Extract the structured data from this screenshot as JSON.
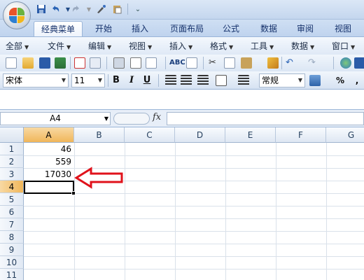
{
  "ribbon_tabs": [
    "经典菜单",
    "开始",
    "插入",
    "页面布局",
    "公式",
    "数据",
    "审阅",
    "视图"
  ],
  "menus": [
    "全部",
    "文件",
    "编辑",
    "视图",
    "插入",
    "格式",
    "工具",
    "数据",
    "窗口"
  ],
  "font": {
    "name": "宋体",
    "size": "11"
  },
  "format_buttons": {
    "bold": "B",
    "italic": "I",
    "underline": "U"
  },
  "number_format": "常规",
  "percent": "%",
  "comma": ",",
  "namebox": "A4",
  "fx_label": "fx",
  "formula_value": "",
  "columns": [
    "A",
    "B",
    "C",
    "D",
    "E",
    "F",
    "G"
  ],
  "rows": [
    "1",
    "2",
    "3",
    "4",
    "5",
    "6",
    "7",
    "8",
    "9",
    "10",
    "11"
  ],
  "cells": {
    "A1": "46",
    "A2": "559",
    "A3": "17030"
  },
  "active_cell": "A4",
  "colors": {
    "accent": "#15316b",
    "arrow": "#e0121b",
    "selected_header": "#f0b65a"
  }
}
